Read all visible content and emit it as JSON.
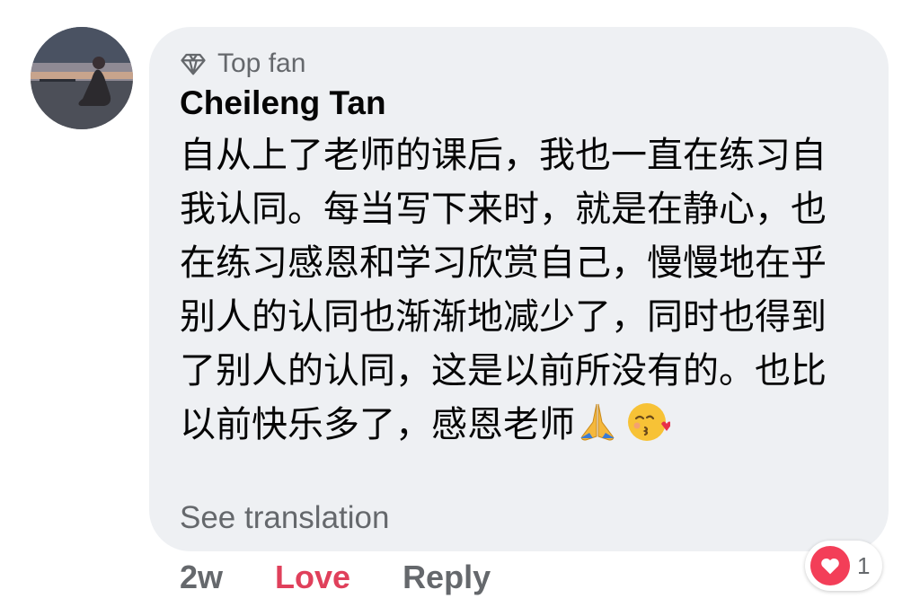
{
  "comment": {
    "badge": {
      "label": "Top fan",
      "icon": "diamond-icon"
    },
    "author": "Cheileng Tan",
    "text": "自从上了老师的课后，我也一直在练习自我认同。每当写下来时，就是在静心，也在练习感恩和学习欣赏自己，慢慢地在乎别人的认同也渐渐地减少了，同时也得到了别人的认同，这是以前所没有的。也比以前快乐多了，感恩老师",
    "emojis": [
      "folded-hands-emoji",
      "face-blowing-kiss-emoji"
    ],
    "see_translation": "See translation",
    "reactions": {
      "icon": "heart-icon",
      "count": "1",
      "color": "#f33e58"
    }
  },
  "actions": {
    "time": "2w",
    "love": "Love",
    "love_color": "#e0405b",
    "reply": "Reply"
  },
  "colors": {
    "bubble": "#eef0f3",
    "secondary_text": "#65686c",
    "primary_text": "#050505"
  }
}
